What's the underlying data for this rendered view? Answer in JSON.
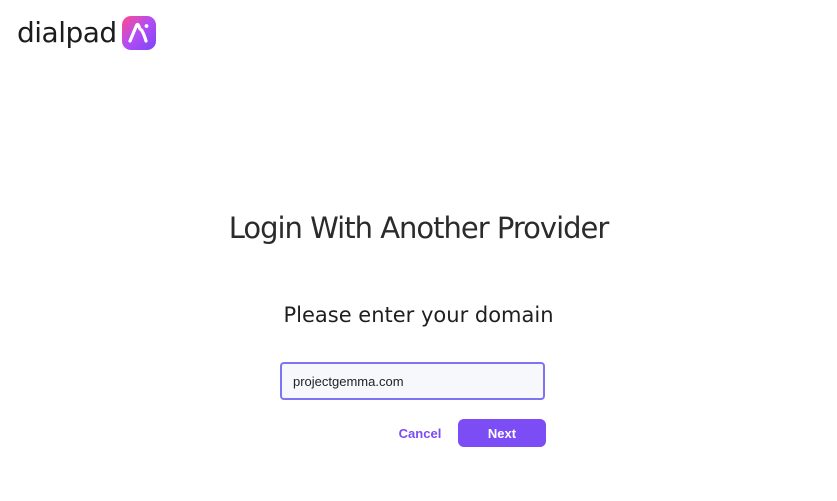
{
  "brand": {
    "wordmark": "dialpad",
    "logo_icon": "dialpad-ai-logo-icon",
    "badge_colors": [
      "#ff4b8b",
      "#b24cf6",
      "#7b45f5"
    ]
  },
  "login": {
    "title": "Login With Another Provider",
    "subtitle": "Please enter your domain",
    "domain_value": "projectgemma.com",
    "cancel_label": "Cancel",
    "next_label": "Next"
  },
  "colors": {
    "accent": "#7c4df5",
    "input_border": "#7c74f2",
    "input_background": "#f7f8fc",
    "text_primary": "#2b2b2b"
  }
}
